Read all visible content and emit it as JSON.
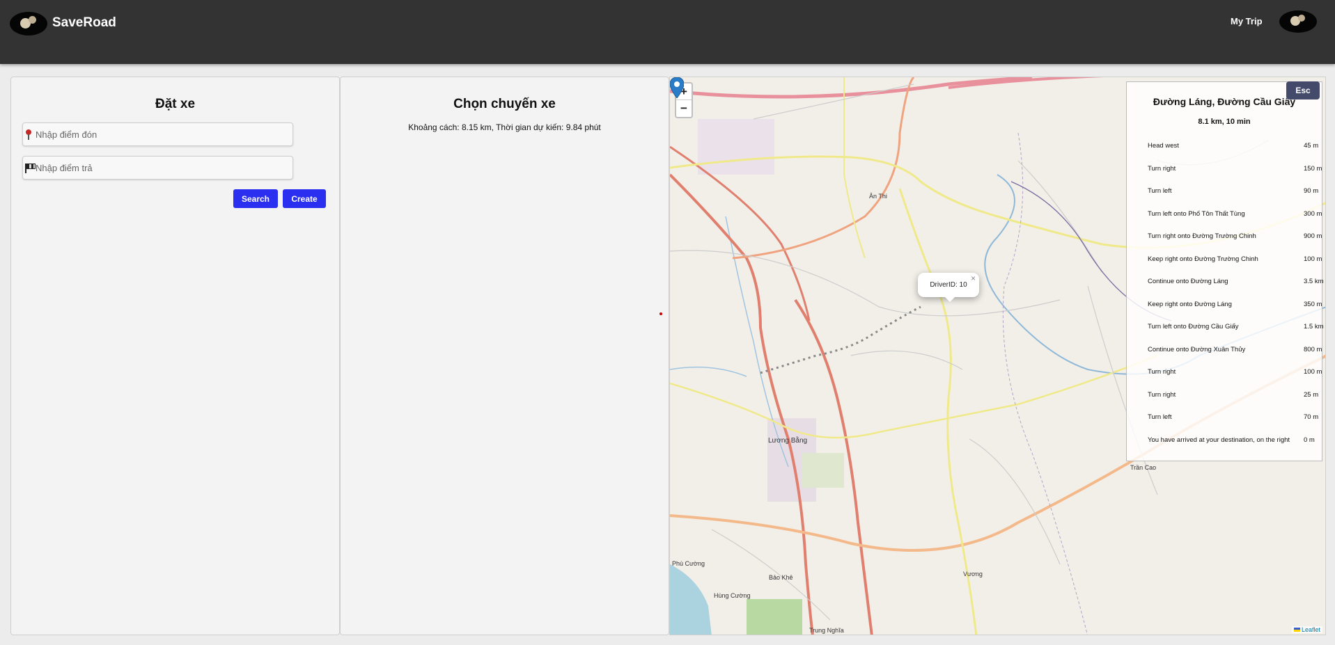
{
  "header": {
    "brand": "SaveRoad",
    "my_trip": "My Trip"
  },
  "booking": {
    "title": "Đặt xe",
    "pickup_placeholder": "Nhập điểm đón",
    "dropoff_placeholder": "Nhập điểm trả",
    "search_label": "Search",
    "create_label": "Create"
  },
  "trip": {
    "title": "Chọn chuyến xe",
    "info": "Khoảng cách: 8.15 km, Thời gian dự kiến: 9.84 phút"
  },
  "map": {
    "zoom_in": "+",
    "zoom_out": "−",
    "popup_text": "DriverID: 10",
    "popup_close": "×",
    "esc_label": "Esc",
    "attribution": "Leaflet",
    "places": [
      "Ân Thi",
      "Lương Bằng",
      "Trần Cao",
      "Vương",
      "Phù Cường",
      "Bảo Khê",
      "Hùng Cường",
      "Trung Nghĩa"
    ],
    "route": {
      "title": "Đường Láng, Đường Cầu Giấy",
      "summary": "8.1 km, 10 min",
      "steps": [
        {
          "instruction": "Head west",
          "distance": "45 m"
        },
        {
          "instruction": "Turn right",
          "distance": "150 m"
        },
        {
          "instruction": "Turn left",
          "distance": "90 m"
        },
        {
          "instruction": "Turn left onto Phố Tôn Thất Tùng",
          "distance": "300 m"
        },
        {
          "instruction": "Turn right onto Đường Trường Chinh",
          "distance": "900 m"
        },
        {
          "instruction": "Keep right onto Đường Trường Chinh",
          "distance": "100 m"
        },
        {
          "instruction": "Continue onto Đường Láng",
          "distance": "3.5 km"
        },
        {
          "instruction": "Keep right onto Đường Láng",
          "distance": "350 m"
        },
        {
          "instruction": "Turn left onto Đường Cầu Giấy",
          "distance": "1.5 km"
        },
        {
          "instruction": "Continue onto Đường Xuân Thủy",
          "distance": "800 m"
        },
        {
          "instruction": "Turn right",
          "distance": "100 m"
        },
        {
          "instruction": "Turn right",
          "distance": "25 m"
        },
        {
          "instruction": "Turn left",
          "distance": "70 m"
        },
        {
          "instruction": "You have arrived at your destination, on the right",
          "distance": "0 m"
        }
      ]
    }
  }
}
